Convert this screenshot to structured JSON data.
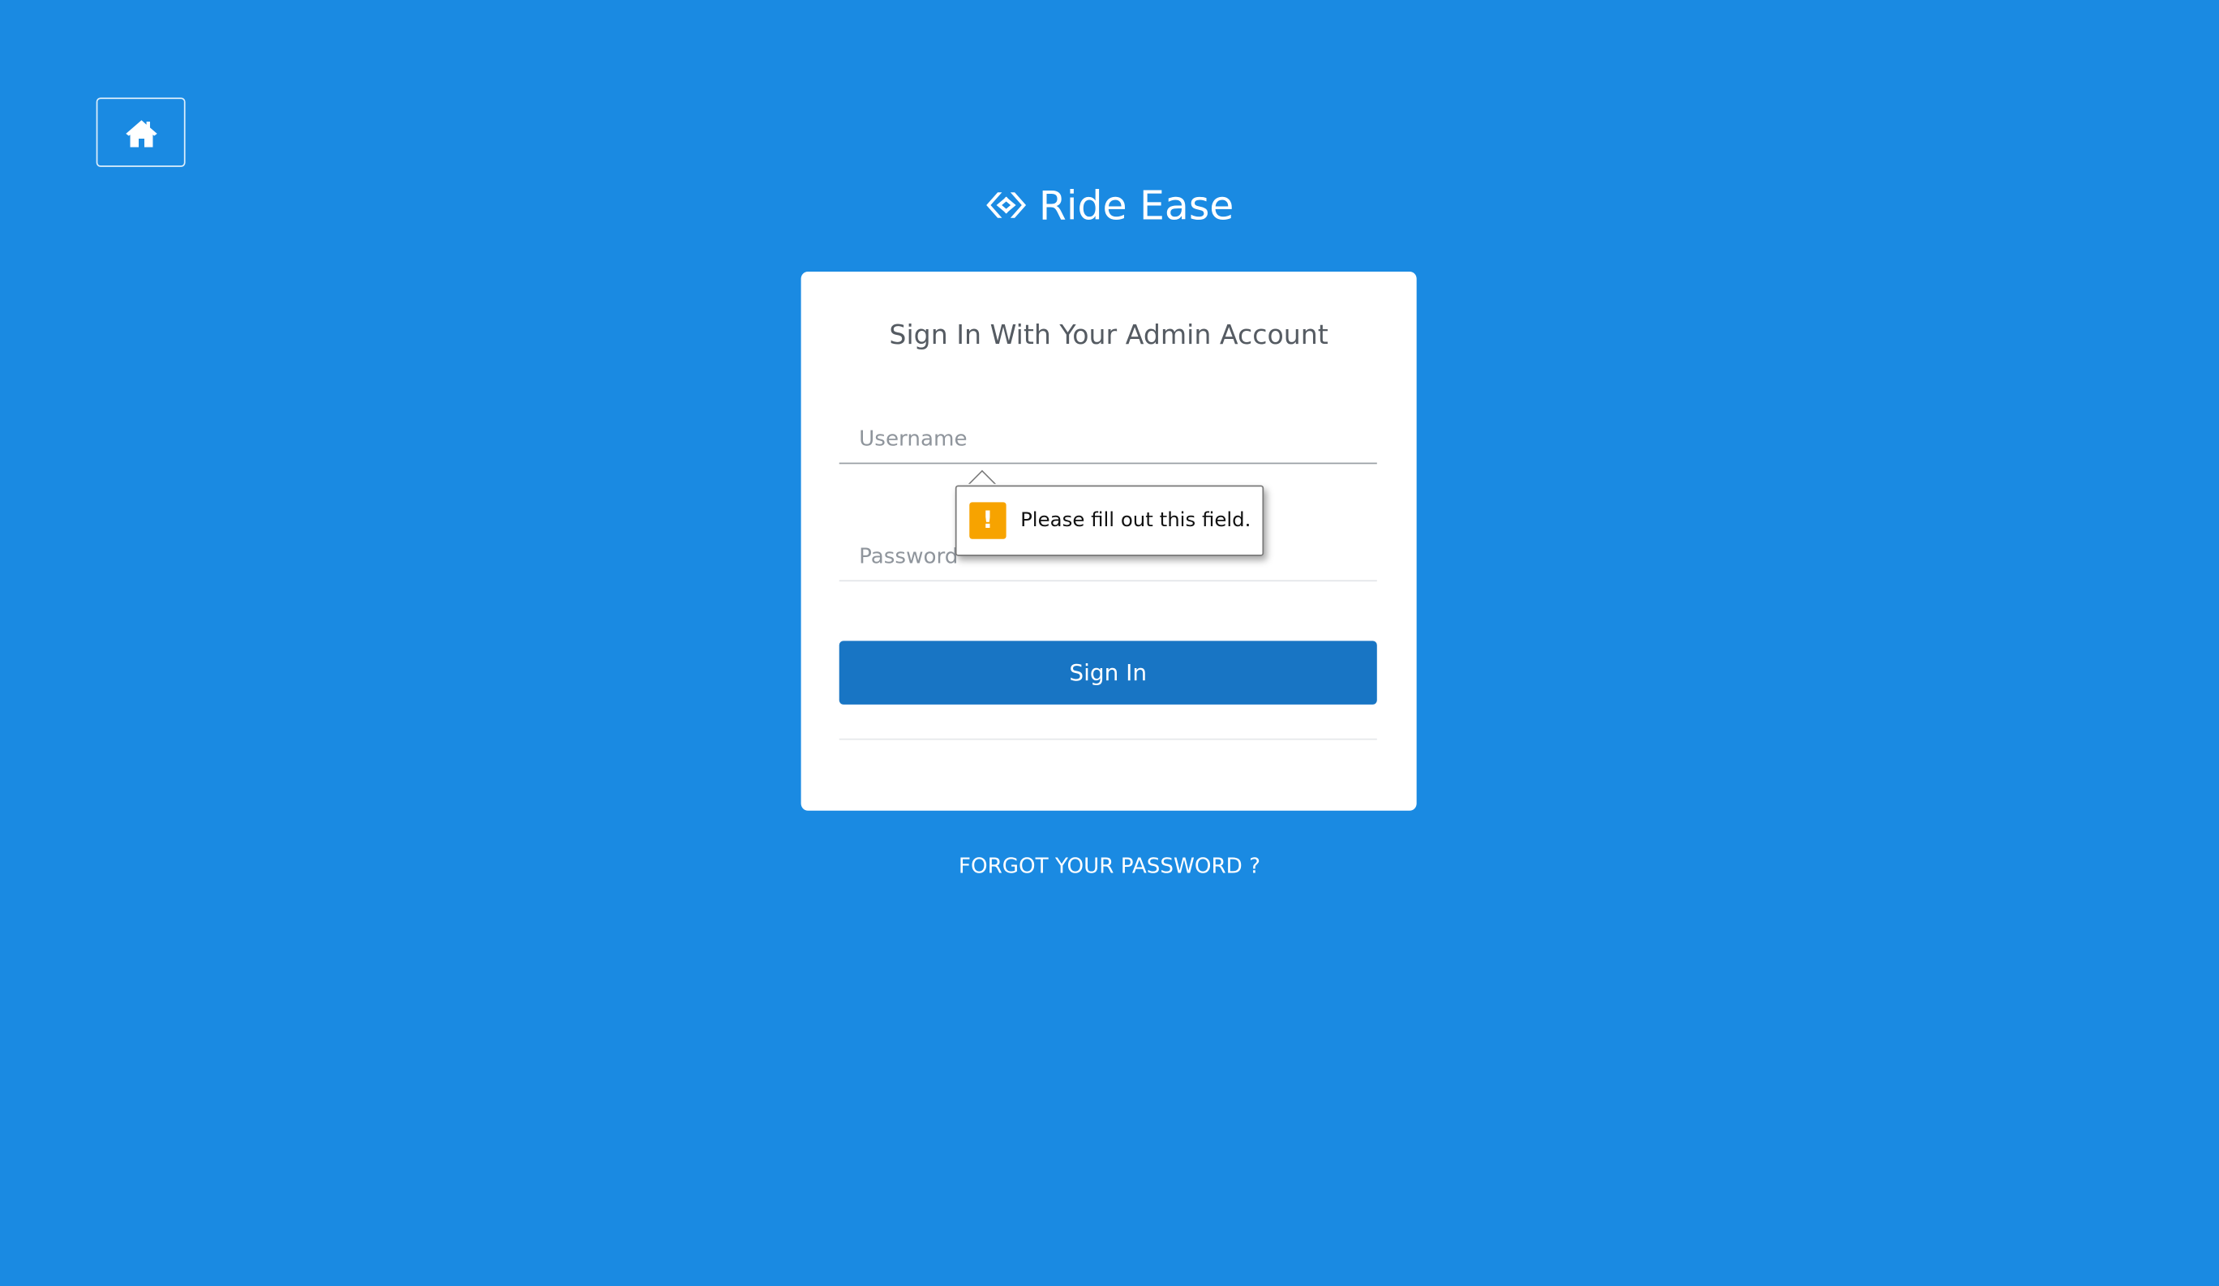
{
  "page": {
    "background_color": "#1a8ae2",
    "accent_color": "#1875c4"
  },
  "header": {
    "home_icon": "home-icon",
    "brand_icon": "ride-ease-logo-icon",
    "brand_name": "Ride Ease"
  },
  "login_card": {
    "title": "Sign In With Your Admin Account",
    "username_placeholder": "Username",
    "username_value": "",
    "password_placeholder": "Password",
    "password_value": "",
    "signin_label": "Sign In"
  },
  "validation_tooltip": {
    "icon": "warning-icon",
    "icon_color": "#f7a300",
    "message": "Please fill out this field."
  },
  "footer": {
    "forgot_password_label": "FORGOT YOUR PASSWORD ?"
  }
}
